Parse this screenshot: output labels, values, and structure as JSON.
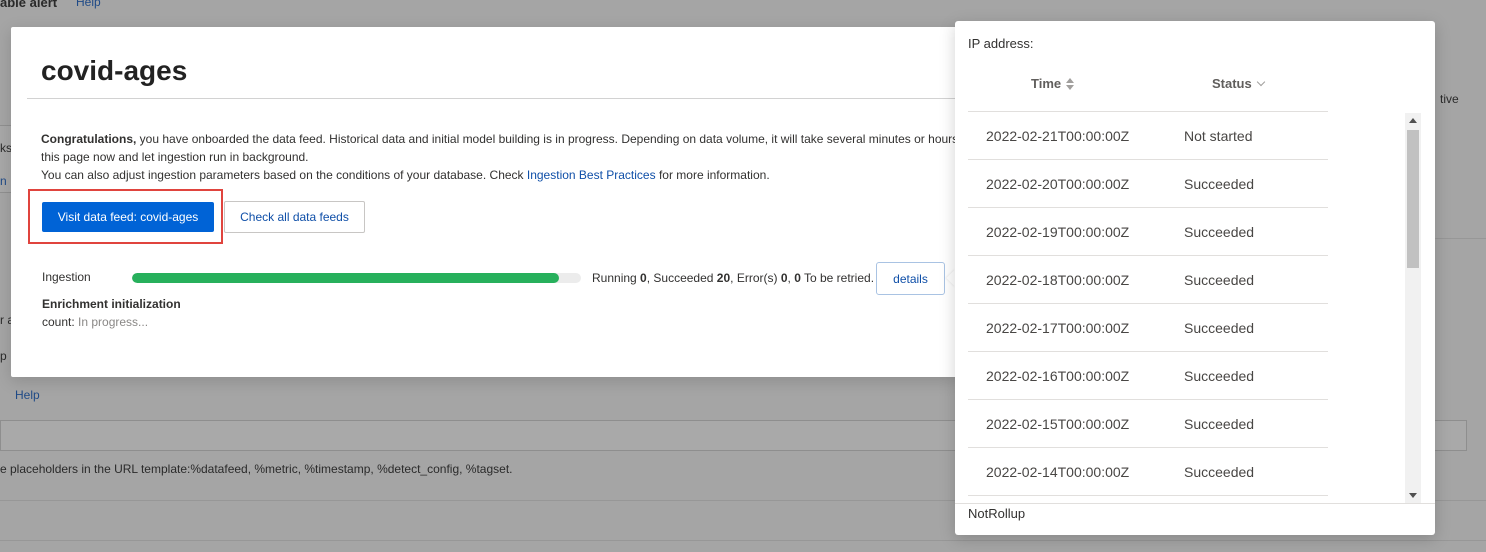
{
  "background": {
    "top_title": "able alert",
    "help": "Help",
    "help2": "Help",
    "native": "tive",
    "frag_ks": "ks",
    "frag_in": "n",
    "frag_a": "r a",
    "frag_p": "p",
    "placeholders_hint": "e placeholders in the URL template:%datafeed, %metric, %timestamp, %detect_config, %tagset."
  },
  "modal": {
    "title": "covid-ages",
    "message": {
      "congrats_bold": "Congratulations,",
      "line1_rest": " you have onboarded the data feed. Historical data and initial model building is in progress. Depending on data volume, it will take several minutes or hours.",
      "line2": "this page now and let ingestion run in background.",
      "line3_pre": "You can also adjust ingestion parameters based on the conditions of your database. Check ",
      "line3_link": "Ingestion Best Practices",
      "line3_post": " for more information."
    },
    "buttons": {
      "visit": "Visit data feed: covid-ages",
      "check_all": "Check all data feeds",
      "details": "details"
    },
    "ingestion": {
      "label": "Ingestion",
      "progress_percent": 95,
      "running_label": "Running ",
      "running": "0",
      "succeeded_label": ", Succeeded ",
      "succeeded": "20",
      "errors_label": ", Error(s) ",
      "errors": "0",
      "sep": ", ",
      "retry": "0",
      "retry_label": " To be retried."
    },
    "enrichment": {
      "title": "Enrichment initialization",
      "count_label": "count: ",
      "count_value": "In progress..."
    }
  },
  "panel": {
    "ip_label": "IP address:",
    "columns": {
      "time": "Time",
      "status": "Status"
    },
    "rows": [
      {
        "time": "2022-02-21T00:00:00Z",
        "status": "Not started"
      },
      {
        "time": "2022-02-20T00:00:00Z",
        "status": "Succeeded"
      },
      {
        "time": "2022-02-19T00:00:00Z",
        "status": "Succeeded"
      },
      {
        "time": "2022-02-18T00:00:00Z",
        "status": "Succeeded"
      },
      {
        "time": "2022-02-17T00:00:00Z",
        "status": "Succeeded"
      },
      {
        "time": "2022-02-16T00:00:00Z",
        "status": "Succeeded"
      },
      {
        "time": "2022-02-15T00:00:00Z",
        "status": "Succeeded"
      },
      {
        "time": "2022-02-14T00:00:00Z",
        "status": "Succeeded"
      },
      {
        "time": "",
        "status": ""
      }
    ],
    "footer": "NotRollup"
  },
  "colors": {
    "primary": "#0063d6",
    "progress": "#27b05c",
    "highlight": "#e0443e",
    "link": "#0f4fa8"
  }
}
